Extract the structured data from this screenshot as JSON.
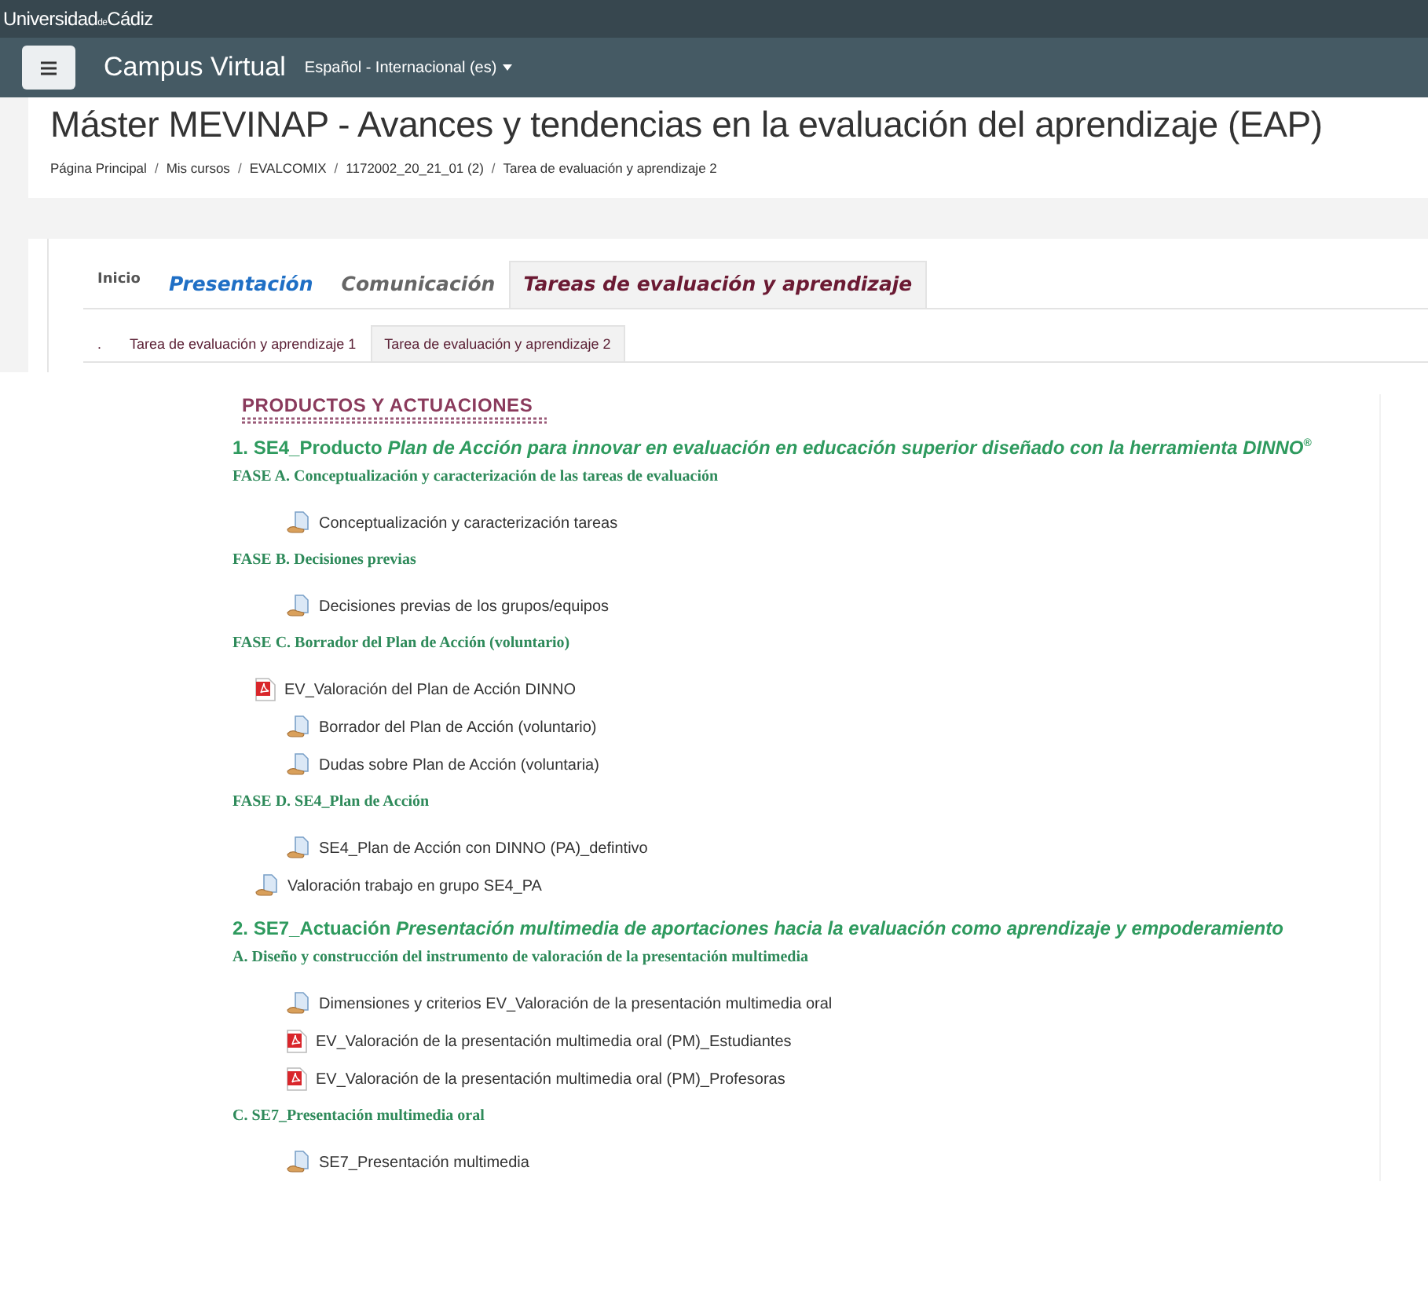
{
  "top_bar": {
    "brand": "Universidad$_{de}$Cádiz"
  },
  "navbar": {
    "site_name": "Campus Virtual",
    "language": "Español - Internacional (es)"
  },
  "page_title": "Máster MEVINAP - Avances y tendencias en la evaluación del aprendizaje (EAP)",
  "breadcrumb_separator": "/",
  "breadcrumb": [
    "Página Principal",
    "Mis cursos",
    "EVALCOMIX",
    "1172002_20_21_01 (2)",
    "Tarea de evaluación y aprendizaje 2"
  ],
  "tabs": [
    {
      "label": "Inicio",
      "kind": "plain",
      "selected": false
    },
    {
      "label": "Presentación",
      "kind": "blue",
      "selected": false
    },
    {
      "label": "Comunicación",
      "kind": "grey",
      "selected": false
    },
    {
      "label": "Tareas de evaluación y aprendizaje",
      "kind": "red",
      "selected": true
    }
  ],
  "subtabs": [
    {
      "label": ".",
      "selected": false
    },
    {
      "label": "Tarea de evaluación y aprendizaje 1",
      "selected": false
    },
    {
      "label": "Tarea de evaluación y aprendizaje 2",
      "selected": true
    }
  ],
  "banner": {
    "title": "PRODUCTOS Y ACTUACIONES"
  },
  "content": [
    {
      "kind": "heading",
      "text": "1. SE4_Producto *Plan de Acción para innovar en evaluación en educación superior diseñado con la herramienta DINNO*$^{®}$"
    },
    {
      "kind": "phase",
      "text": "FASE A. Conceptualización y caracterización de las tareas de evaluación"
    },
    {
      "kind": "assignment",
      "indented": true,
      "text": "Conceptualización y caracterización tareas"
    },
    {
      "kind": "phase",
      "text": "FASE B. Decisiones previas"
    },
    {
      "kind": "assignment",
      "indented": true,
      "text": "Decisiones previas de los grupos/equipos"
    },
    {
      "kind": "phase",
      "text": "FASE C. Borrador del Plan de Acción (voluntario)"
    },
    {
      "kind": "pdf",
      "indented": false,
      "text": "EV_Valoración del Plan de Acción DINNO"
    },
    {
      "kind": "assignment",
      "indented": true,
      "text": "Borrador del Plan de Acción (voluntario)"
    },
    {
      "kind": "assignment",
      "indented": true,
      "text": "Dudas sobre Plan de Acción (voluntaria)"
    },
    {
      "kind": "phase",
      "text": "FASE D. SE4_Plan de Acción"
    },
    {
      "kind": "assignment",
      "indented": true,
      "text": "SE4_Plan de Acción con DINNO (PA)_defintivo"
    },
    {
      "kind": "assignment",
      "indented": false,
      "text": "Valoración trabajo en grupo SE4_PA"
    },
    {
      "kind": "heading",
      "text": "2. SE7_Actuación *Presentación multimedia de aportaciones hacia la evaluación como aprendizaje y empoderamiento*"
    },
    {
      "kind": "phase",
      "text": "A. Diseño y construcción del instrumento de valoración de la presentación multimedia"
    },
    {
      "kind": "assignment",
      "indented": true,
      "text": "Dimensiones y criterios EV_Valoración de la presentación multimedia oral"
    },
    {
      "kind": "pdf",
      "indented": true,
      "text": "EV_Valoración de la presentación multimedia oral (PM)_Estudiantes"
    },
    {
      "kind": "pdf",
      "indented": true,
      "text": "EV_Valoración de la presentación multimedia oral (PM)_Profesoras"
    },
    {
      "kind": "phase",
      "text": "C. SE7_Presentación multimedia oral"
    },
    {
      "kind": "assignment",
      "indented": true,
      "text": "SE7_Presentación multimedia"
    }
  ]
}
